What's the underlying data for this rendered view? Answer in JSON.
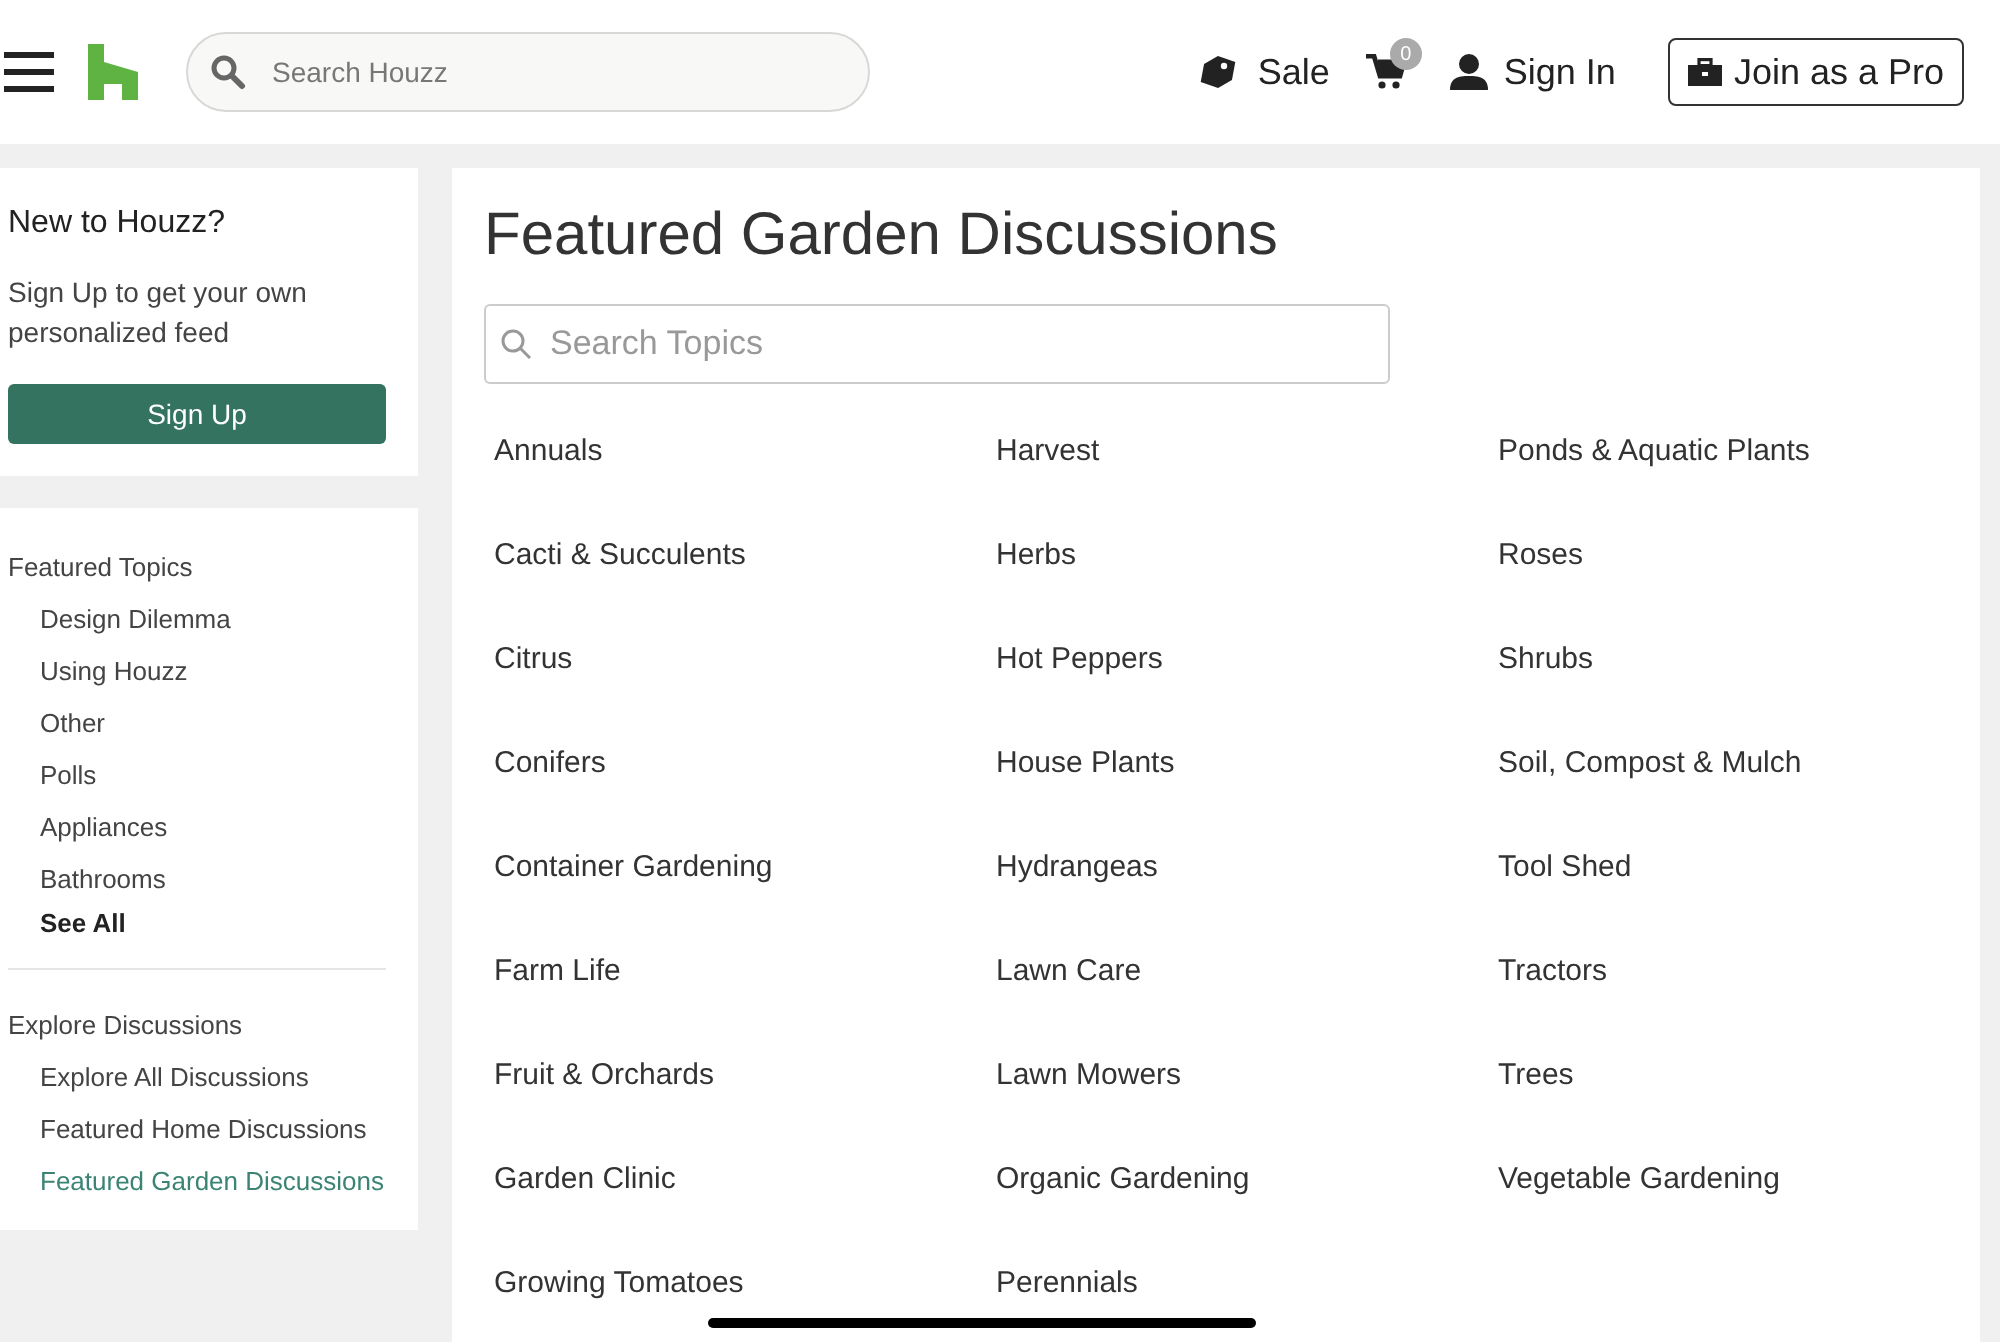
{
  "header": {
    "search": {
      "placeholder": "Search Houzz"
    },
    "sale": "Sale",
    "cart_count": "0",
    "sign_in": "Sign In",
    "join_button": "Join as a Pro"
  },
  "signup_card": {
    "title": "New to Houzz?",
    "text": "Sign Up to get your own personalized feed",
    "button": "Sign Up"
  },
  "nav_sections": [
    {
      "heading": "Featured Topics",
      "items": [
        {
          "label": "Design Dilemma",
          "selected": false
        },
        {
          "label": "Using Houzz",
          "selected": false
        },
        {
          "label": "Other",
          "selected": false
        },
        {
          "label": "Polls",
          "selected": false
        },
        {
          "label": "Appliances",
          "selected": false
        },
        {
          "label": "Bathrooms",
          "selected": false
        }
      ],
      "see_all": "See All"
    },
    {
      "heading": "Explore Discussions",
      "items": [
        {
          "label": "Explore All Discussions",
          "selected": false
        },
        {
          "label": "Featured Home Discussions",
          "selected": false
        },
        {
          "label": "Featured Garden Discussions",
          "selected": true
        }
      ]
    }
  ],
  "main": {
    "title": "Featured Garden Discussions",
    "search": {
      "placeholder": "Search Topics"
    },
    "topics": [
      "Annuals",
      "Harvest",
      "Ponds & Aquatic Plants",
      "Cacti & Succulents",
      "Herbs",
      "Roses",
      "Citrus",
      "Hot Peppers",
      "Shrubs",
      "Conifers",
      "House Plants",
      "Soil, Compost & Mulch",
      "Container Gardening",
      "Hydrangeas",
      "Tool Shed",
      "Farm Life",
      "Lawn Care",
      "Tractors",
      "Fruit & Orchards",
      "Lawn Mowers",
      "Trees",
      "Garden Clinic",
      "Organic Gardening",
      "Vegetable Gardening",
      "Growing Tomatoes",
      "Perennials"
    ]
  }
}
